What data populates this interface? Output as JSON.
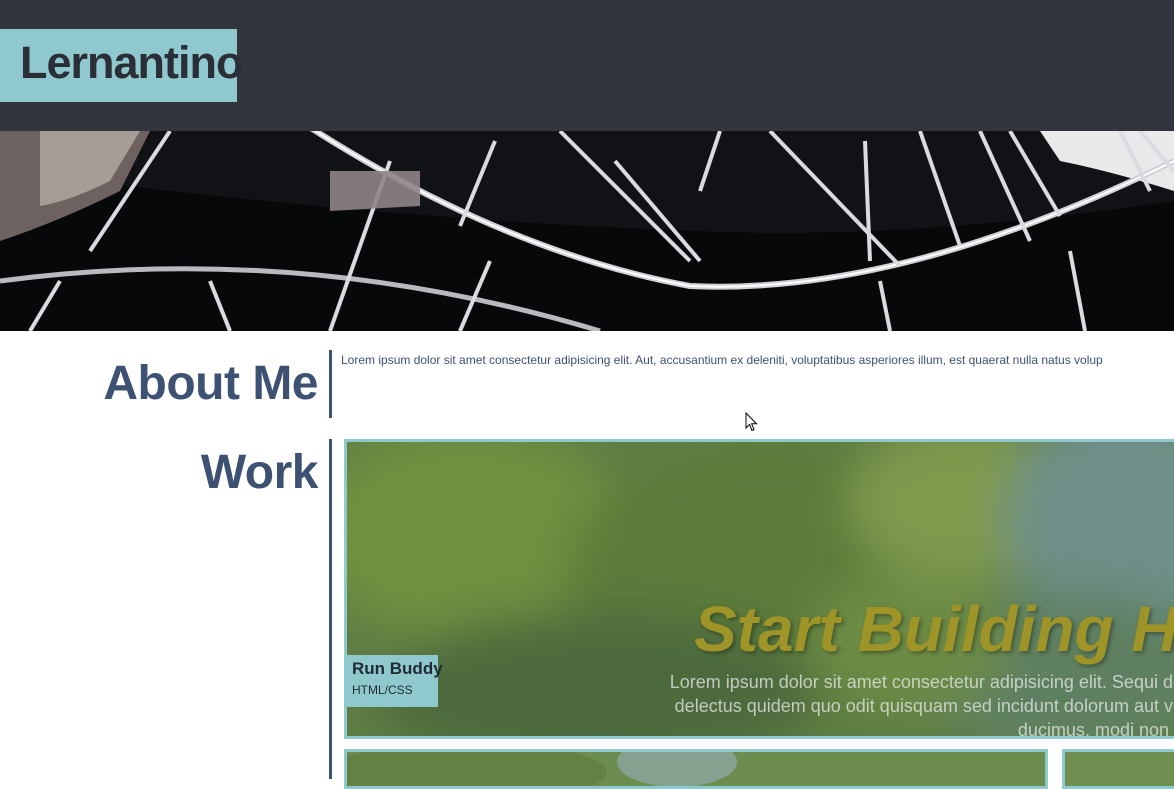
{
  "header": {
    "brand": "Lernantino"
  },
  "about": {
    "title": "About Me",
    "text": "Lorem ipsum dolor sit amet consectetur adipisicing elit. Aut, accusantium ex deleniti, voluptatibus asperiores illum, est quaerat nulla natus volup"
  },
  "work": {
    "title": "Work",
    "featured": {
      "headline": "Start Building H",
      "body_lines": [
        "Lorem ipsum dolor sit amet consectetur adipisicing elit. Sequi de",
        "delectus quidem quo odit quisquam sed incidunt dolorum aut ve",
        "ducimus, modi non c"
      ],
      "label_title": "Run Buddy",
      "label_sub": "HTML/CSS"
    }
  },
  "colors": {
    "header_bg": "#32353d",
    "accent": "#8fc9cd",
    "heading": "#3d5172"
  }
}
